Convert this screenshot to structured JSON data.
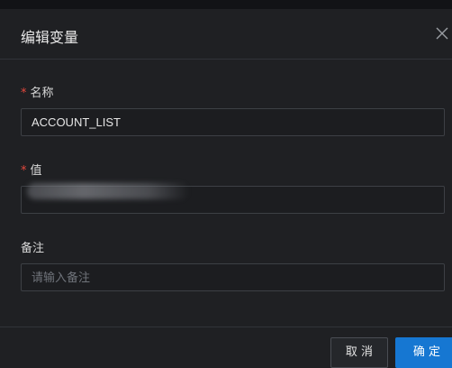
{
  "dialog": {
    "title": "编辑变量",
    "close_icon": "close-icon"
  },
  "form": {
    "name_field": {
      "required_mark": "*",
      "label": "名称",
      "value": "ACCOUNT_LIST"
    },
    "value_field": {
      "required_mark": "*",
      "label": "值",
      "value_masked": true
    },
    "remark_field": {
      "label": "备注",
      "placeholder": "请输入备注"
    }
  },
  "footer": {
    "cancel_label": "取 消",
    "confirm_label": "确 定"
  },
  "colors": {
    "accent": "#1677d2",
    "required": "#e4483d",
    "background": "#1f2023"
  }
}
